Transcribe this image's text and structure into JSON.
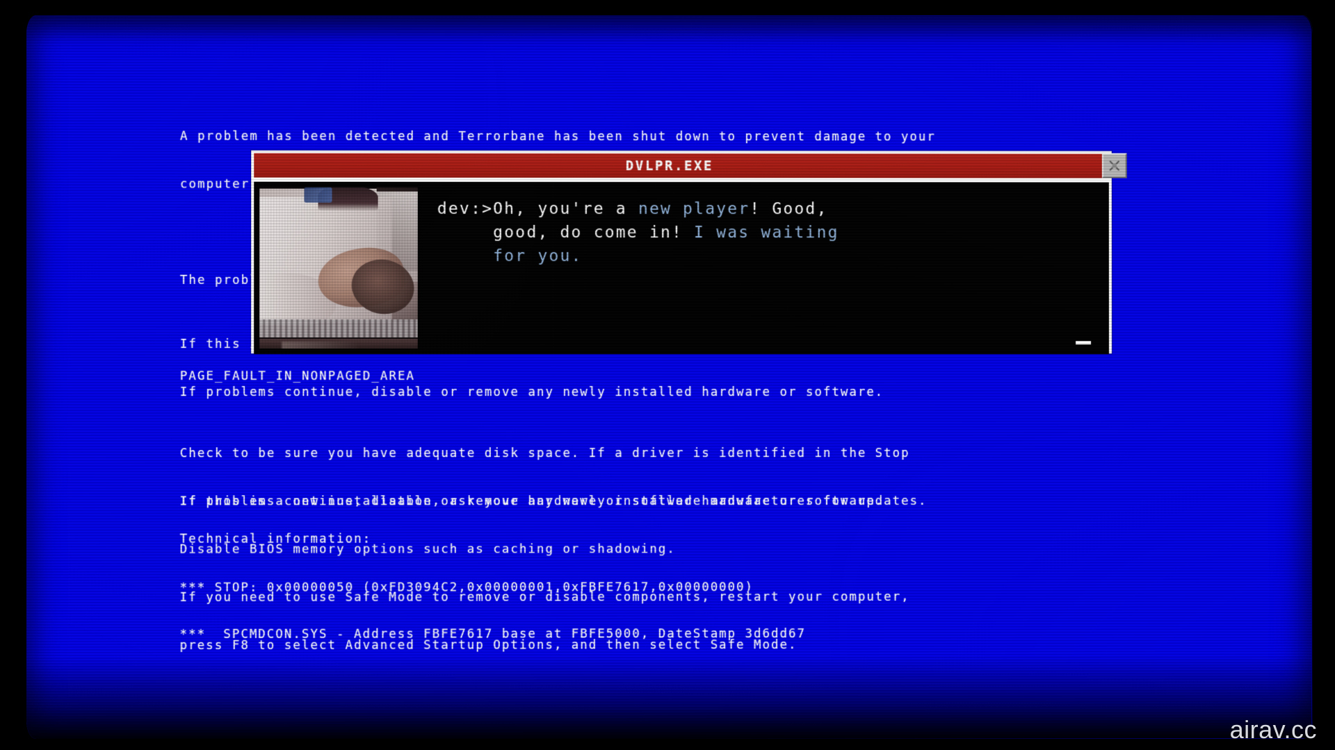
{
  "screen": {
    "background_color": "#0000E6",
    "text_color": "#FFFFFF"
  },
  "bsod": {
    "intro_lines": [
      "A problem has been detected and Terrorbane has been shut down to prevent damage to your",
      "computer.",
      "",
      "The problem seems to be caused by the following file: SPCMDCON.SYS",
      "",
      "PAGE_FAULT_IN_NONPAGED_AREA"
    ],
    "mid_lines": [
      "If this is the first time you've seen this Stop error screen,",
      "If problems continue, disable or remove any newly installed hardware or software."
    ],
    "tail_lines": [
      "Check to be sure you have adequate disk space. If a driver is identified in the Stop",
      "If this is a new installation, ask your hardware or software manufacturer for updates."
    ],
    "body_lines": [
      "If problems continue, disable or remove any newly installed hardware or software.",
      "Disable BIOS memory options such as caching or shadowing.",
      "If you need to use Safe Mode to remove or disable components, restart your computer,",
      "press F8 to select Advanced Startup Options, and then select Safe Mode."
    ],
    "technical_heading": "Technical information:",
    "stop_line": "*** STOP: 0x00000050 (0xFD3094C2,0x00000001,0xFBFE7617,0x00000000)",
    "driver_line": "***  SPCMDCON.SYS - Address FBFE7617 base at FBFE5000, DateStamp 3d6dd67"
  },
  "dialog": {
    "title": "DVLPR.EXE",
    "titlebar_color": "#A91C14",
    "close_icon": "close-x-icon",
    "speaker": "dev:>",
    "highlight_color": "#93B6DE",
    "line1_a": "Oh, you're a ",
    "line1_b": "new player",
    "line1_c": "! Good,",
    "line2_a": "good, do come in! ",
    "line2_b": "I was waiting",
    "line3_b": "for you.",
    "cursor": "_"
  },
  "watermark": {
    "text": "airav.cc"
  }
}
